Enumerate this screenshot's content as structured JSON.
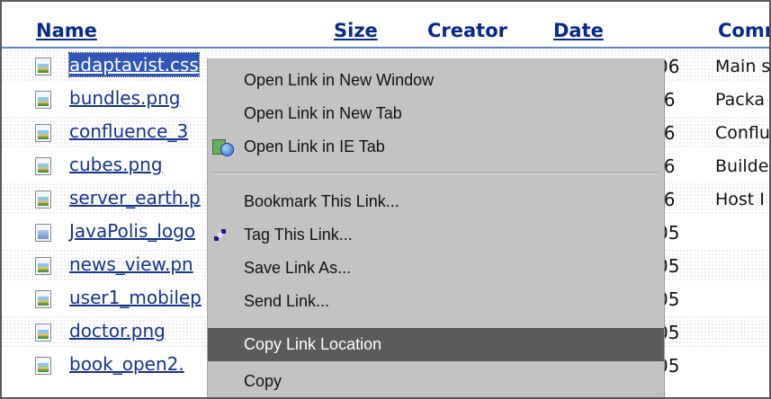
{
  "columns": {
    "name": "Name",
    "size": "Size",
    "creator": "Creator",
    "date": "Date",
    "comment": "Comm"
  },
  "files": [
    {
      "name": "adaptavist.css",
      "date_tail": "06",
      "comment": "Main s",
      "icon": "image-file-icon",
      "selected": true
    },
    {
      "name": "bundles.png",
      "date_tail": ")6",
      "comment": "Packa",
      "icon": "image-file-icon"
    },
    {
      "name": "confluence_3",
      "date_tail": ")6",
      "comment": "Conflu",
      "icon": "image-file-icon"
    },
    {
      "name": "cubes.png",
      "date_tail": ")6",
      "comment": "Builde",
      "icon": "image-file-icon"
    },
    {
      "name": "server_earth.p",
      "date_tail": ")6",
      "comment": "Host I",
      "icon": "image-file-icon"
    },
    {
      "name": "JavaPolis_logo",
      "date_tail": "05",
      "comment": "",
      "icon": "gif-file-icon"
    },
    {
      "name": "news_view.pn",
      "date_tail": "05",
      "comment": "",
      "icon": "image-file-icon"
    },
    {
      "name": "user1_mobilep",
      "date_tail": "05",
      "comment": "",
      "icon": "image-file-icon"
    },
    {
      "name": "doctor.png",
      "date_tail": "05",
      "comment": "",
      "icon": "image-file-icon"
    },
    {
      "name": "book_open2.",
      "date_tail": "05",
      "comment": "",
      "icon": "image-file-icon"
    }
  ],
  "context_menu": {
    "items": [
      {
        "label": "Open Link in New Window",
        "icon": null
      },
      {
        "label": "Open Link in New Tab",
        "icon": null
      },
      {
        "label": "Open Link in IE Tab",
        "icon": "ie-tab-icon"
      },
      {
        "label": "Bookmark This Link...",
        "icon": null
      },
      {
        "label": "Tag This Link...",
        "icon": "tag-icon"
      },
      {
        "label": "Save Link As...",
        "icon": null
      },
      {
        "label": "Send Link...",
        "icon": null
      },
      {
        "label": "Copy Link Location",
        "icon": null,
        "active": true
      },
      {
        "label": "Copy",
        "icon": null
      }
    ]
  },
  "colors": {
    "link": "#15338c",
    "header": "#0a2a8a",
    "selection": "#2f55b8",
    "menu_background": "#c3c3c3",
    "menu_highlight": "#5b5b5b"
  }
}
